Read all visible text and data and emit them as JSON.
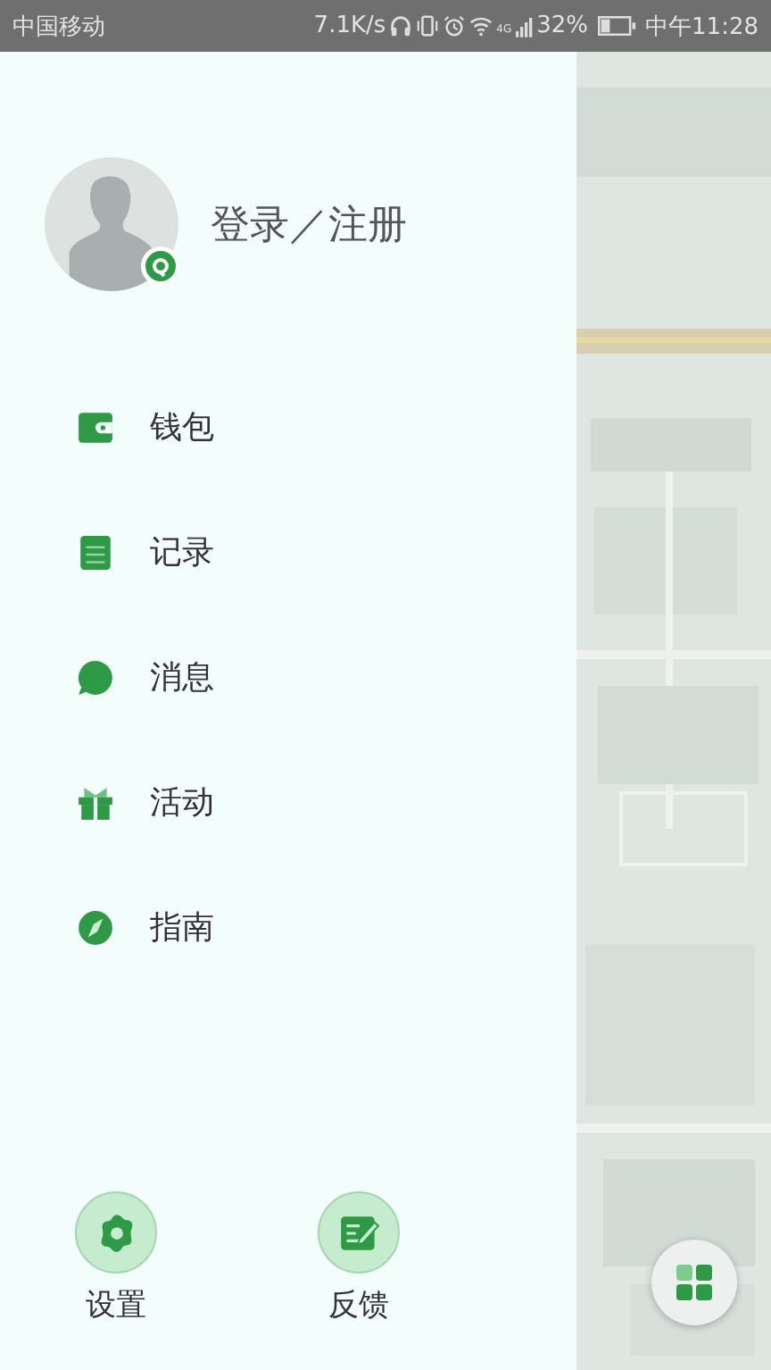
{
  "status_bar": {
    "carrier": "中国移动",
    "speed": "7.1K/s",
    "network": "4G",
    "battery": "32%",
    "time": "中午11:28"
  },
  "profile": {
    "login_label": "登录／注册"
  },
  "menu": [
    {
      "kind": "wallet",
      "label": "钱包"
    },
    {
      "kind": "record",
      "label": "记录"
    },
    {
      "kind": "message",
      "label": "消息"
    },
    {
      "kind": "gift",
      "label": "活动"
    },
    {
      "kind": "guide",
      "label": "指南"
    }
  ],
  "bottom_buttons": [
    {
      "kind": "settings",
      "label": "设置"
    },
    {
      "kind": "feedback",
      "label": "反馈"
    }
  ]
}
